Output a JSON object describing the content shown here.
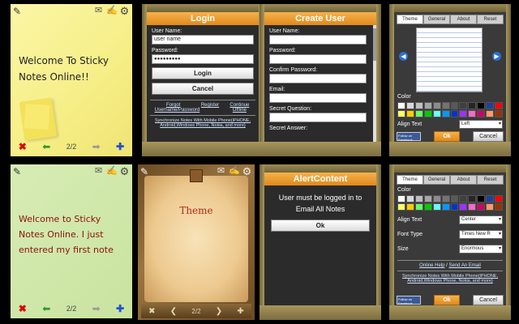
{
  "notes": {
    "note1": {
      "text": "Welcome To Sticky Notes Online!!",
      "counter": "2/2"
    },
    "note2": {
      "text": "Welcome to Sticky Notes Online. I just entered my first note",
      "counter": "2/2"
    }
  },
  "login": {
    "title": "Login",
    "username_label": "User Name:",
    "username_value": "user name",
    "password_label": "Password:",
    "password_value": "●●●●●●●●●",
    "login_button": "Login",
    "cancel_button": "Cancel",
    "forgot_link": "Forgot Username/Password",
    "register_link": "Register",
    "offline_link": "Continue Offline",
    "sync_text": "Synchronize Notes With Mobile Phone(iPHONE, Android,Windows Phone, Nokia, and more)"
  },
  "create_user": {
    "title": "Create User",
    "labels": [
      "User Name:",
      "Password:",
      "Confirm Password:",
      "Email:",
      "Secret Question:",
      "Secret Answer:"
    ]
  },
  "settings1": {
    "tabs": [
      "Theme",
      "General",
      "About",
      "Reset"
    ],
    "color_label": "Color",
    "align_label": "Align Text",
    "align_value": "Left",
    "fb_text": "Follow on Facebook",
    "ok": "Ok",
    "cancel": "Cancel"
  },
  "theme_panel": {
    "label": "Theme"
  },
  "alert": {
    "title": "AlertContent",
    "message": "User must be logged in to Email All Notes",
    "ok": "Ok"
  },
  "settings2": {
    "tabs": [
      "Theme",
      "General",
      "About",
      "Reset"
    ],
    "color_label": "Color",
    "align_label": "Align Text",
    "align_value": "Center",
    "font_label": "Font Type",
    "font_value": "Times New R",
    "size_label": "Size",
    "size_value": "Enormous",
    "help_link": "Online Help",
    "sep": "/",
    "email_link": "Send An Email",
    "sync_text": "Synchronize Notes With Mobile Phone(iPHONE, Android,Windows Phone, Nokia, and more)",
    "fb_text": "Follow on Facebook",
    "ok": "Ok",
    "cancel": "Cancel"
  },
  "colors": {
    "accent": "#e8961f",
    "swatches": [
      "#ffffff",
      "#d9d9d9",
      "#bfbfbf",
      "#a6a6a6",
      "#8c8c8c",
      "#737373",
      "#595959",
      "#404040",
      "#262626",
      "#000000",
      "#1f3f9f",
      "#ff0000",
      "#ffff66",
      "#ffcc00",
      "#66ff66",
      "#00cc00",
      "#66ffff",
      "#0099ff",
      "#0033cc",
      "#9933ff",
      "#ff66cc",
      "#cc0066",
      "#ff9966",
      "#993300"
    ]
  }
}
